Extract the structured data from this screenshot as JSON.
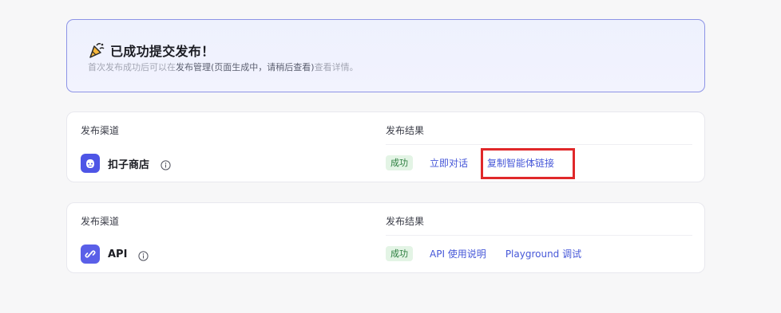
{
  "banner": {
    "title": "已成功提交发布！",
    "desc_prefix": "首次发布成功后可以在",
    "desc_middle": "发布管理(页面生成中，请稍后查看)",
    "desc_suffix": "查看详情。"
  },
  "cards": [
    {
      "col_channel": "发布渠道",
      "col_result": "发布结果",
      "channel_name": "扣子商店",
      "channel_icon": "store-robot-icon",
      "status": "成功",
      "link1": "立即对话",
      "link2": "复制智能体链接"
    },
    {
      "col_channel": "发布渠道",
      "col_result": "发布结果",
      "channel_name": "API",
      "channel_icon": "api-link-icon",
      "status": "成功",
      "link1": "API 使用说明",
      "link2": "Playground 调试"
    }
  ],
  "colors": {
    "accent": "#4657d8",
    "banner_border": "#8d94e6",
    "success_bg": "#e3f4e5",
    "success_text": "#2b7d3e",
    "highlight": "#e0282a"
  }
}
